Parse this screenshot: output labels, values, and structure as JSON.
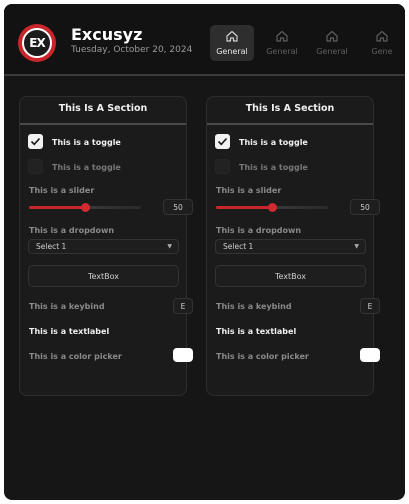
{
  "app": {
    "brand": "Excusyz",
    "logo_text": "EX",
    "date": "Tuesday, October 20, 2024"
  },
  "tabs": [
    {
      "label": "General",
      "icon": "home-icon",
      "active": true
    },
    {
      "label": "General",
      "icon": "home-icon",
      "active": false
    },
    {
      "label": "General",
      "icon": "home-icon",
      "active": false
    },
    {
      "label": "Gene",
      "icon": "home-icon",
      "active": false
    }
  ],
  "sections": [
    {
      "title": "This Is A Section",
      "toggle1": {
        "label": "This is a toggle",
        "checked": true
      },
      "toggle2": {
        "label": "This is a toggle",
        "checked": false
      },
      "slider": {
        "label": "This is a slider",
        "value": "50",
        "fraction": 0.5
      },
      "dropdown": {
        "label": "This is a dropdown",
        "selected": "Select 1"
      },
      "textbox": {
        "label": "TextBox"
      },
      "keybind": {
        "label": "This is a keybind",
        "key": "E"
      },
      "textlabel": {
        "label": "This is a textlabel"
      },
      "colorpicker": {
        "label": "This is a color picker",
        "color": "#ffffff"
      }
    },
    {
      "title": "This Is A Section",
      "toggle1": {
        "label": "This is a toggle",
        "checked": true
      },
      "toggle2": {
        "label": "This is a toggle",
        "checked": false
      },
      "slider": {
        "label": "This is a slider",
        "value": "50",
        "fraction": 0.5
      },
      "dropdown": {
        "label": "This is a dropdown",
        "selected": "Select 1"
      },
      "textbox": {
        "label": "TextBox"
      },
      "keybind": {
        "label": "This is a keybind",
        "key": "E"
      },
      "textlabel": {
        "label": "This is a textlabel"
      },
      "colorpicker": {
        "label": "This is a color picker",
        "color": "#ffffff"
      }
    }
  ],
  "colors": {
    "accent": "#c8262b",
    "background": "#161616",
    "panel": "#1b1b1b"
  }
}
